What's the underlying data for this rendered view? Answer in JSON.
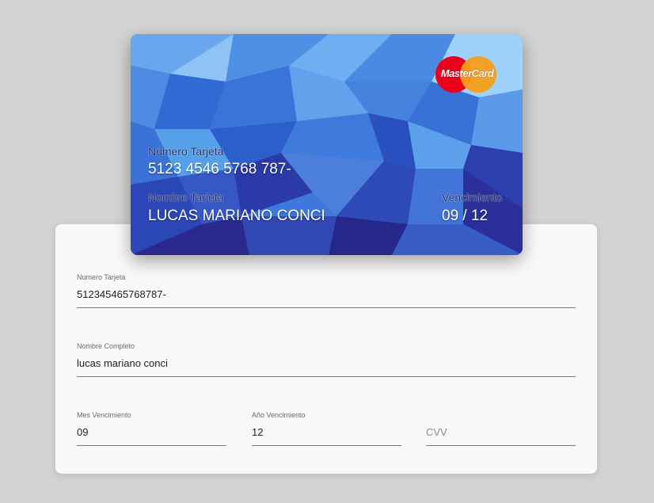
{
  "card": {
    "number_label": "Número Tarjeta",
    "number_value": "5123 4546 5768 787-",
    "name_label": "Nombre Tarjeta",
    "name_value": "LUCAS MARIANO CONCI",
    "expiry_label": "Vencimiento",
    "expiry_value": "09 / 12",
    "brand": "MasterCard",
    "brand_colors": {
      "red": "#eb001b",
      "orange": "#f79e1b"
    }
  },
  "form": {
    "card_number": {
      "label": "Numero Tarjeta",
      "value": "512345465768787-"
    },
    "full_name": {
      "label": "Nombre Completo",
      "value": "lucas mariano conci"
    },
    "exp_month": {
      "label": "Mes Vencimiento",
      "value": "09"
    },
    "exp_year": {
      "label": "Año Vencimiento",
      "value": "12"
    },
    "cvv": {
      "placeholder": "CVV",
      "value": ""
    }
  },
  "colors": {
    "background": "#d3d3d3",
    "panel": "#f9f9f9",
    "card_base": "#3e76d8"
  }
}
